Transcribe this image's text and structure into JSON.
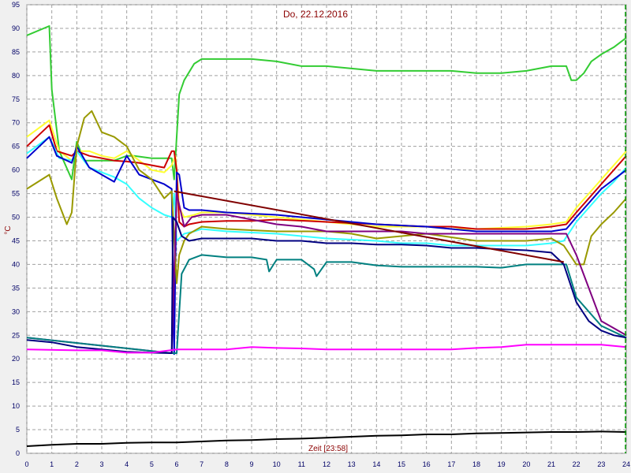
{
  "chart_data": {
    "type": "line",
    "title": "Do, 22.12.2016",
    "xlabel": "Zeit [23:58]",
    "ylabel": "°C",
    "xlim": [
      0,
      24
    ],
    "ylim": [
      0,
      95
    ],
    "xticks": [
      0,
      1,
      2,
      3,
      4,
      5,
      6,
      7,
      8,
      9,
      10,
      11,
      12,
      13,
      14,
      15,
      16,
      17,
      18,
      19,
      20,
      21,
      22,
      23,
      24
    ],
    "yticks": [
      0,
      5,
      10,
      15,
      20,
      25,
      30,
      35,
      40,
      45,
      50,
      55,
      60,
      65,
      70,
      75,
      80,
      85,
      90,
      95
    ],
    "grid": true,
    "cursor_x": 24,
    "series": [
      {
        "color": "#33cc33",
        "x": [
          0,
          0.9,
          1.0,
          1.3,
          1.8,
          2.0,
          2.3,
          3.0,
          3.5,
          4.0,
          4.3,
          5.0,
          5.8,
          5.9,
          6.1,
          6.3,
          6.7,
          7.0,
          8.0,
          9.0,
          10.0,
          11.0,
          12.0,
          13.0,
          14.0,
          15.0,
          16.0,
          17.0,
          18.0,
          19.0,
          20.0,
          21.0,
          21.6,
          21.8,
          22.0,
          22.3,
          22.6,
          23.0,
          23.5,
          24.0
        ],
        "y": [
          88.5,
          90.5,
          77,
          64,
          58,
          66,
          62,
          62,
          62,
          63,
          63,
          62.5,
          62.5,
          58,
          76,
          79,
          82.5,
          83.5,
          83.5,
          83.5,
          83,
          82,
          82,
          81.5,
          81,
          81,
          81,
          81,
          80.5,
          80.5,
          81,
          82,
          82,
          79,
          79,
          80.5,
          83,
          84.5,
          86,
          88
        ]
      },
      {
        "color": "#ffff33",
        "x": [
          0,
          0.9,
          1.3,
          1.8,
          2.0,
          2.5,
          3.0,
          3.5,
          4.0,
          4.5,
          5.0,
          5.5,
          5.8,
          5.95,
          6.0,
          6.1,
          6.3,
          6.7,
          7.0,
          8.0,
          10.0,
          12.0,
          14.0,
          16.0,
          17.0,
          18.0,
          20.0,
          21.0,
          21.6,
          22.0,
          22.5,
          23.0,
          23.5,
          24.0
        ],
        "y": [
          67,
          70.5,
          64,
          62,
          64,
          64,
          63,
          62.5,
          64,
          62,
          60,
          59.5,
          61,
          63,
          60,
          52,
          50,
          50.5,
          51,
          51,
          50,
          49,
          48,
          48,
          47.5,
          47.5,
          48,
          48.5,
          49,
          52,
          55,
          58,
          61,
          64
        ]
      },
      {
        "color": "#cc0000",
        "x": [
          0,
          0.9,
          1.2,
          1.8,
          2.0,
          2.5,
          3.0,
          3.5,
          4.0,
          4.5,
          5.0,
          5.5,
          5.8,
          5.9,
          6.0,
          6.1,
          6.3,
          6.5,
          7.0,
          8.0,
          9.0,
          10.0,
          12.0,
          14.0,
          16.0,
          17.0,
          18.0,
          20.0,
          21.0,
          21.6,
          22.0,
          22.5,
          23.0,
          23.5,
          24.0
        ],
        "y": [
          65,
          69.5,
          64,
          63,
          64,
          63,
          62.5,
          62,
          61.8,
          61.5,
          61,
          60.5,
          64,
          64,
          60,
          49,
          48,
          48.5,
          49,
          49.2,
          49.2,
          49.5,
          49,
          48.5,
          48,
          48,
          47.5,
          47.5,
          48,
          48.5,
          51,
          54,
          57,
          60,
          63
        ]
      },
      {
        "color": "#33ffff",
        "x": [
          0,
          0.9,
          1.3,
          1.8,
          2.0,
          2.5,
          3.0,
          3.5,
          4.0,
          4.5,
          5.0,
          5.5,
          5.8,
          5.9,
          6.0,
          6.3,
          6.7,
          7.0,
          8.0,
          10.0,
          11.0,
          12.0,
          14.0,
          15.0,
          16.0,
          17.0,
          18.0,
          20.0,
          21.0,
          21.5,
          22.0,
          22.5,
          23.0,
          23.5,
          24.0
        ],
        "y": [
          63.5,
          67,
          62.5,
          62,
          64,
          60.5,
          59.5,
          58.5,
          57,
          54,
          52,
          50.5,
          50,
          55,
          45,
          46.5,
          47,
          47.5,
          47,
          46.5,
          46,
          45.5,
          45,
          44.5,
          44.5,
          44,
          44,
          44,
          44.5,
          45,
          49,
          52,
          55,
          57.5,
          60.5
        ]
      },
      {
        "color": "#0000cc",
        "x": [
          0,
          0.9,
          1.2,
          1.8,
          2.0,
          2.5,
          3.0,
          3.5,
          4.0,
          4.5,
          5.0,
          5.5,
          5.8,
          5.9,
          6.0,
          6.1,
          6.3,
          6.5,
          7.0,
          8.0,
          10.0,
          12.0,
          14.0,
          16.0,
          17.0,
          18.0,
          20.0,
          21.0,
          21.6,
          22.0,
          22.5,
          23.0,
          23.5,
          24.0
        ],
        "y": [
          62.5,
          67,
          63,
          61.5,
          65,
          60.5,
          59,
          57.5,
          63,
          59,
          58,
          57,
          56,
          21,
          59.5,
          59,
          52,
          51.5,
          51.5,
          51,
          50.5,
          49.5,
          48.5,
          48,
          47.5,
          47,
          47,
          47,
          47.5,
          50,
          53,
          56,
          58,
          60
        ]
      },
      {
        "color": "#999900",
        "x": [
          0,
          0.9,
          1.2,
          1.6,
          1.8,
          2.0,
          2.3,
          2.6,
          3.0,
          3.5,
          4.0,
          4.5,
          5.0,
          5.5,
          5.8,
          6.0,
          6.1,
          6.3,
          6.5,
          7.0,
          8.0,
          10.0,
          12.0,
          13.0,
          14.0,
          16.0,
          18.0,
          20.0,
          21.0,
          21.5,
          22.0,
          22.3,
          22.6,
          23.0,
          23.5,
          24.0
        ],
        "y": [
          56,
          59,
          54,
          48.5,
          51,
          65,
          71,
          72.5,
          68,
          67,
          65,
          60,
          58,
          54,
          55.5,
          36,
          42,
          45,
          46.5,
          48,
          47.5,
          47,
          47,
          46.5,
          45.5,
          46.5,
          45,
          45,
          45.5,
          44,
          40,
          40,
          46,
          48.5,
          51,
          54
        ]
      },
      {
        "color": "#800080",
        "x": [
          0,
          5.8,
          6.0,
          6.3,
          6.6,
          7.0,
          7.5,
          8.0,
          9.0,
          10.0,
          11.0,
          12.0,
          13.0,
          14.0,
          15.0,
          16.0,
          17.0,
          18.0,
          19.0,
          20.0,
          21.0,
          21.6,
          22.0,
          23.0,
          24.0
        ],
        "y": [
          24.5,
          21.2,
          55,
          48,
          50,
          50.5,
          50.5,
          50.5,
          49.5,
          48.5,
          48,
          47,
          47,
          47,
          47,
          46.5,
          46.5,
          46.5,
          46.5,
          46.5,
          46.5,
          46.5,
          42,
          28,
          25
        ]
      },
      {
        "color": "#008080",
        "x": [
          0,
          5.8,
          6.0,
          6.2,
          6.5,
          7.0,
          8.0,
          9.0,
          9.6,
          9.7,
          10.0,
          11.0,
          11.5,
          11.6,
          12.0,
          13.0,
          14.0,
          15.0,
          16.0,
          17.0,
          18.0,
          19.0,
          20.0,
          21.0,
          21.6,
          22.0,
          23.0,
          24.0
        ],
        "y": [
          24.5,
          21.2,
          21.2,
          38,
          41,
          42,
          41.5,
          41.5,
          41,
          38.5,
          41,
          41,
          39,
          37.5,
          40.5,
          40.5,
          39.8,
          39.5,
          39.5,
          39.5,
          39.5,
          39.3,
          40,
          40,
          40,
          33,
          27,
          24.5
        ]
      },
      {
        "color": "#000080",
        "x": [
          0,
          1.0,
          2.0,
          3.0,
          4.0,
          5.0,
          5.8,
          5.85,
          6.0,
          6.2,
          6.5,
          7.0,
          8.0,
          9.0,
          10.0,
          11.0,
          12.0,
          13.0,
          14.0,
          15.0,
          16.0,
          17.0,
          18.0,
          19.0,
          20.0,
          21.0,
          21.5,
          22.0,
          22.5,
          23.0,
          23.5,
          24.0
        ],
        "y": [
          24,
          23.5,
          22.5,
          22,
          21.5,
          21.3,
          21.2,
          50,
          49,
          46,
          45,
          45.5,
          45.5,
          45.5,
          45,
          45,
          44.5,
          44.5,
          44.2,
          44.2,
          44,
          43.5,
          43.5,
          43.2,
          43,
          42.5,
          40,
          32,
          28,
          26,
          25,
          24.5
        ]
      },
      {
        "color": "#800000",
        "x": [
          5.9,
          21.5
        ],
        "y": [
          55.5,
          40.5
        ]
      },
      {
        "color": "#ff00ff",
        "x": [
          0,
          2.0,
          3.0,
          4.0,
          5.0,
          6.0,
          7.0,
          8.0,
          9.0,
          10.0,
          11.0,
          12.0,
          13.0,
          14.0,
          15.0,
          16.0,
          17.0,
          18.0,
          19.0,
          20.0,
          21.0,
          22.0,
          23.0,
          24.0
        ],
        "y": [
          22,
          21.8,
          21.8,
          21.3,
          21.3,
          22,
          22,
          22,
          22.5,
          22.3,
          22.2,
          22,
          22,
          22,
          22,
          22,
          22,
          22.3,
          22.5,
          23,
          23,
          23,
          23,
          22.5
        ]
      },
      {
        "color": "#000000",
        "x": [
          0,
          1,
          2,
          3,
          4,
          5,
          6,
          7,
          8,
          9,
          10,
          11,
          12,
          13,
          14,
          15,
          16,
          17,
          18,
          19,
          20,
          21,
          22,
          23,
          24
        ],
        "y": [
          1.5,
          1.8,
          2,
          2,
          2.2,
          2.3,
          2.3,
          2.5,
          2.7,
          2.8,
          3,
          3.1,
          3.3,
          3.5,
          3.7,
          3.8,
          4,
          4,
          4.2,
          4.3,
          4.4,
          4.5,
          4.5,
          4.6,
          4.5
        ]
      }
    ]
  }
}
